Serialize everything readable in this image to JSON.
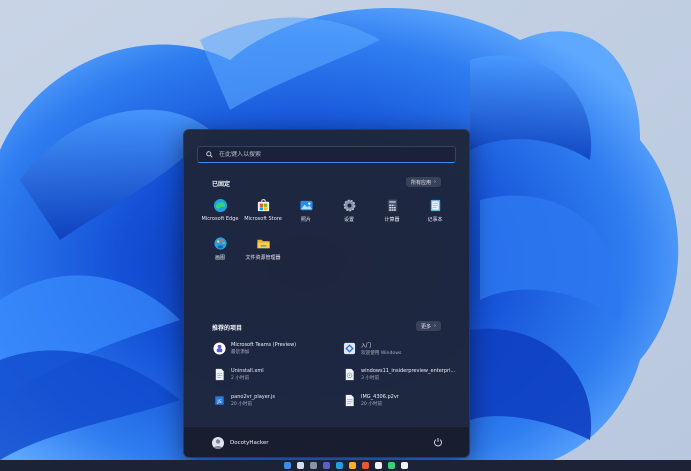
{
  "search": {
    "placeholder": "在此键入以搜索"
  },
  "pinned": {
    "title": "已固定",
    "all_apps_label": "所有应用",
    "apps": [
      {
        "label": "Microsoft Edge",
        "icon": "edge-icon"
      },
      {
        "label": "Microsoft Store",
        "icon": "store-icon"
      },
      {
        "label": "照片",
        "icon": "photos-icon"
      },
      {
        "label": "设置",
        "icon": "settings-icon"
      },
      {
        "label": "计算器",
        "icon": "calculator-icon"
      },
      {
        "label": "记事本",
        "icon": "notepad-icon"
      },
      {
        "label": "画图",
        "icon": "paint-icon"
      },
      {
        "label": "文件资源管理器",
        "icon": "file-explorer-icon"
      }
    ]
  },
  "recommended": {
    "title": "推荐的项目",
    "more_label": "更多",
    "items": [
      {
        "name": "Microsoft Teams (Preview)",
        "sub": "最近添加",
        "icon": "teams-icon"
      },
      {
        "name": "入门",
        "sub": "欢迎使用 Windows",
        "icon": "get-started-icon"
      },
      {
        "name": "Uninstall.xml",
        "sub": "2 小时前",
        "icon": "xml-file-icon"
      },
      {
        "name": "windows11_insiderpreview_enterpri...",
        "sub": "3 小时前",
        "icon": "iso-file-icon"
      },
      {
        "name": "pano2vr_player.js",
        "sub": "20 小时前",
        "icon": "js-file-icon"
      },
      {
        "name": "IMG_4306.p2vr",
        "sub": "20 小时前",
        "icon": "p2vr-file-icon"
      }
    ]
  },
  "user": {
    "name": "DocotyHacker"
  },
  "colors": {
    "accent": "#3d8be8",
    "panel": "#1f263c",
    "wallpaper": "#1a5fd6"
  }
}
